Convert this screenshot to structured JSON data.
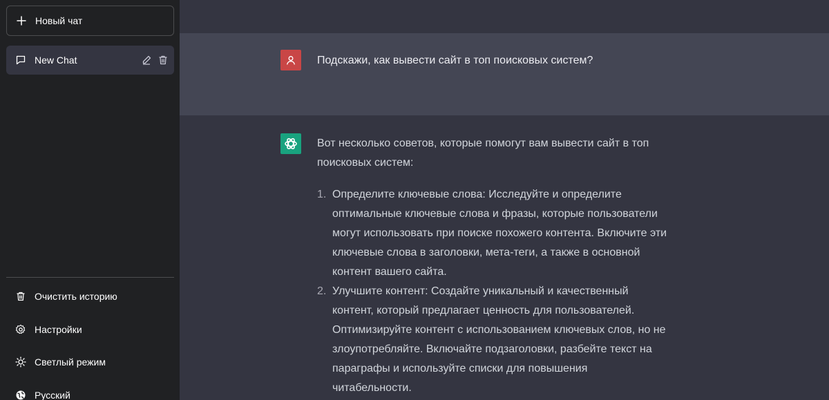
{
  "sidebar": {
    "new_chat_label": "Новый чат",
    "chats": [
      {
        "label": "New Chat"
      }
    ],
    "menu": [
      {
        "label": "Очистить историю",
        "icon": "trash-icon"
      },
      {
        "label": "Настройки",
        "icon": "gear-icon"
      },
      {
        "label": "Светлый режим",
        "icon": "sun-icon"
      },
      {
        "label": "Русский",
        "icon": "globe-icon"
      }
    ]
  },
  "conversation": {
    "user_message": "Подскажи, как вывести сайт в топ поисковых систем?",
    "assistant_intro": "Вот несколько советов, которые помогут вам вывести сайт в топ поисковых систем:",
    "assistant_list": [
      {
        "num": "1.",
        "text": "Определите ключевые слова: Исследуйте и определите оптимальные ключевые слова и фразы, которые пользователи могут использовать при поиске похожего контента. Включите эти ключевые слова в заголовки, мета-теги, а также в основной контент вашего сайта."
      },
      {
        "num": "2.",
        "text": "Улучшите контент: Создайте уникальный и качественный контент, который предлагает ценность для пользователей. Оптимизируйте контент с использованием ключевых слов, но не злоупотребляйте. Включайте подзаголовки, разбейте текст на параграфы и используйте списки для повышения читабельности."
      }
    ]
  },
  "colors": {
    "sidebar_bg": "#202123",
    "main_bg": "#343541",
    "user_msg_bg": "#444654",
    "user_avatar": "#c94646",
    "bot_avatar": "#19a37f"
  }
}
